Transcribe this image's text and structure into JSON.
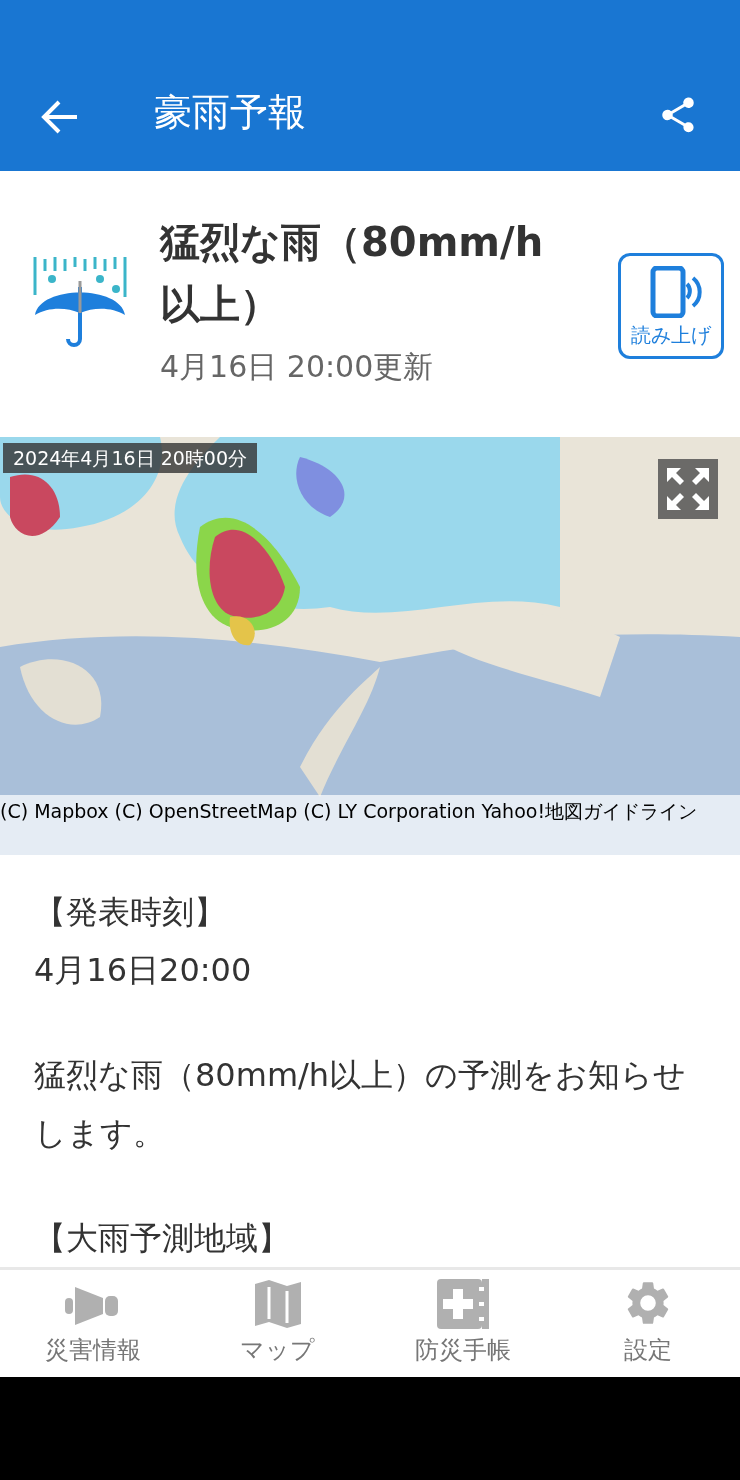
{
  "app_bar": {
    "title": "豪雨予報"
  },
  "header": {
    "title": "猛烈な雨（80mm/h以上）",
    "updated": "4月16日 20:00更新",
    "read_aloud_button": "読み上げ"
  },
  "map": {
    "timestamp": "2024年4月16日 20時00分",
    "attribution": "(C) Mapbox (C) OpenStreetMap (C) LY Corporation Yahoo!地図ガイドライン"
  },
  "body": [
    {
      "kind": "heading",
      "text": "【発表時刻】"
    },
    {
      "kind": "line",
      "text": "4月16日20:00"
    },
    {
      "kind": "gap"
    },
    {
      "kind": "paragraph",
      "text": "猛烈な雨（80mm/h以上）の予測をお知らせします。"
    },
    {
      "kind": "gap"
    },
    {
      "kind": "heading",
      "text": "【大雨予測地域】"
    }
  ],
  "bottom_nav": [
    {
      "kind": "megaphone",
      "label": "災害情報"
    },
    {
      "kind": "map",
      "label": "マップ"
    },
    {
      "kind": "notebook",
      "label": "防災手帳"
    },
    {
      "kind": "gear",
      "label": "設定"
    }
  ]
}
